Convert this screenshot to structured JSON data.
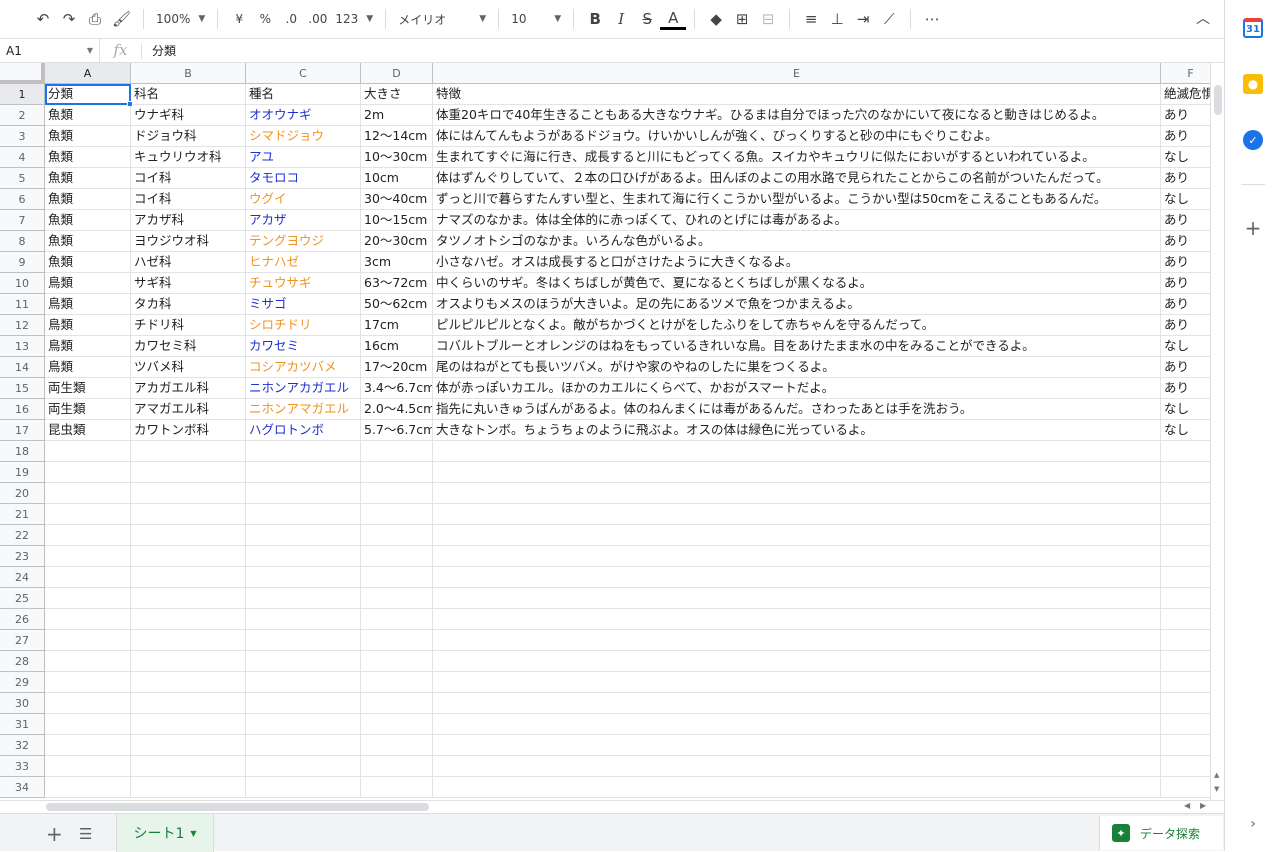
{
  "toolbar": {
    "undo_icon": "undo-icon",
    "redo_icon": "redo-icon",
    "zoom": "100%",
    "currency": "¥",
    "percent": "%",
    "dec_decrease": ".0",
    "dec_increase": ".00",
    "number_format": "123",
    "font": "メイリオ",
    "font_size": "10",
    "bold": "B",
    "italic": "I",
    "strike": "S",
    "text_color": "A",
    "more": "⋯"
  },
  "formula_bar": {
    "cell_ref": "A1",
    "fx": "fx",
    "value": "分類"
  },
  "columns": [
    "A",
    "B",
    "C",
    "D",
    "E",
    "F"
  ],
  "rows": [
    [
      "分類",
      "科名",
      "種名",
      "大きさ",
      "特徴",
      "絶滅危惧"
    ],
    [
      "魚類",
      "ウナギ科",
      "オオウナギ",
      "2m",
      "体重20キロで40年生きることもある大きなウナギ。ひるまは自分でほった穴のなかにいて夜になると動きはじめるよ。",
      "あり"
    ],
    [
      "魚類",
      "ドジョウ科",
      "シマドジョウ",
      "12～14cm",
      "体にはんてんもようがあるドジョウ。けいかいしんが強く、びっくりすると砂の中にもぐりこむよ。",
      "あり"
    ],
    [
      "魚類",
      "キュウリウオ科",
      "アユ",
      "10～30cm",
      "生まれてすぐに海に行き、成長すると川にもどってくる魚。スイカやキュウリに似たにおいがするといわれているよ。",
      "なし"
    ],
    [
      "魚類",
      "コイ科",
      "タモロコ",
      "10cm",
      "体はずんぐりしていて、２本の口ひげがあるよ。田んぼのよこの用水路で見られたことからこの名前がついたんだって。",
      "あり"
    ],
    [
      "魚類",
      "コイ科",
      "ウグイ",
      "30～40cm",
      "ずっと川で暮らすたんすい型と、生まれて海に行くこうかい型がいるよ。こうかい型は50cmをこえることもあるんだ。",
      "なし"
    ],
    [
      "魚類",
      "アカザ科",
      "アカザ",
      "10～15cm",
      "ナマズのなかま。体は全体的に赤っぽくて、ひれのとげには毒があるよ。",
      "あり"
    ],
    [
      "魚類",
      "ヨウジウオ科",
      "テングヨウジ",
      "20～30cm",
      "タツノオトシゴのなかま。いろんな色がいるよ。",
      "あり"
    ],
    [
      "魚類",
      "ハゼ科",
      "ヒナハゼ",
      "3cm",
      "小さなハゼ。オスは成長すると口がさけたように大きくなるよ。",
      "あり"
    ],
    [
      "鳥類",
      "サギ科",
      "チュウサギ",
      "63～72cm",
      "中くらいのサギ。冬はくちばしが黄色で、夏になるとくちばしが黒くなるよ。",
      "あり"
    ],
    [
      "鳥類",
      "タカ科",
      "ミサゴ",
      "50～62cm",
      "オスよりもメスのほうが大きいよ。足の先にあるツメで魚をつかまえるよ。",
      "あり"
    ],
    [
      "鳥類",
      "チドリ科",
      "シロチドリ",
      "17cm",
      "ピルピルピルとなくよ。敵がちかづくとけがをしたふりをして赤ちゃんを守るんだって。",
      "あり"
    ],
    [
      "鳥類",
      "カワセミ科",
      "カワセミ",
      "16cm",
      "コバルトブルーとオレンジのはねをもっているきれいな鳥。目をあけたまま水の中をみることができるよ。",
      "なし"
    ],
    [
      "鳥類",
      "ツバメ科",
      "コシアカツバメ",
      "17～20cm",
      "尾のはねがとても長いツバメ。がけや家のやねのしたに巣をつくるよ。",
      "あり"
    ],
    [
      "両生類",
      "アカガエル科",
      "ニホンアカガエル",
      "3.4～6.7cm",
      "体が赤っぽいカエル。ほかのカエルにくらべて、かおがスマートだよ。",
      "あり"
    ],
    [
      "両生類",
      "アマガエル科",
      "ニホンアマガエル",
      "2.0～4.5cm",
      "指先に丸いきゅうばんがあるよ。体のねんまくには毒があるんだ。さわったあとは手を洗おう。",
      "なし"
    ],
    [
      "昆虫類",
      "カワトンボ科",
      "ハグロトンボ",
      "5.7～6.7cm",
      "大きなトンボ。ちょうちょのように飛ぶよ。オスの体は緑色に光っているよ。",
      "なし"
    ]
  ],
  "species_colors": [
    "",
    "blue",
    "orange",
    "blue",
    "blue",
    "orange",
    "blue",
    "orange",
    "orange",
    "orange",
    "blue",
    "orange",
    "blue",
    "orange",
    "blue",
    "orange",
    "blue"
  ],
  "total_rows": 34,
  "colors": {
    "blue": "#1f30d0",
    "orange": "#f0931f",
    "accent": "#1a73e8",
    "sheet_green": "#188038"
  },
  "sheet_bar": {
    "sheet_name": "シート1",
    "explore_label": "データ探索"
  }
}
